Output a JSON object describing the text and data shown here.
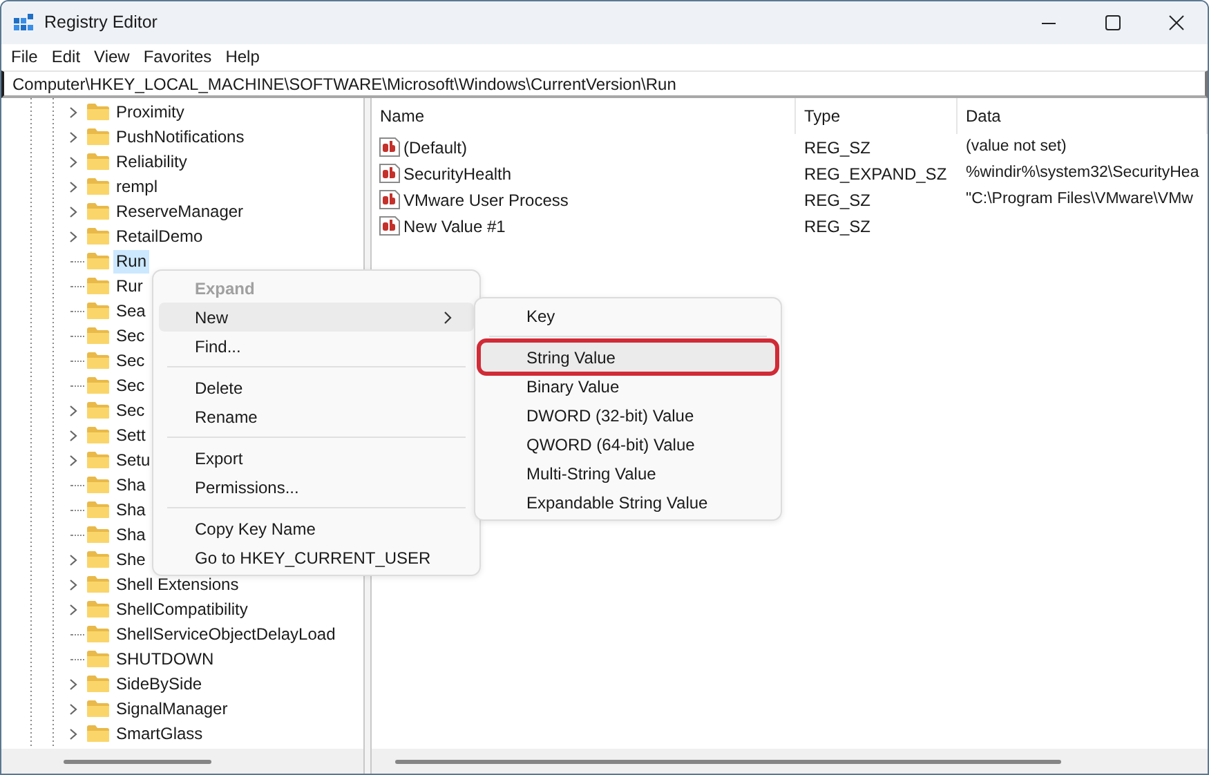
{
  "window": {
    "title": "Registry Editor"
  },
  "menu_bar": [
    "File",
    "Edit",
    "View",
    "Favorites",
    "Help"
  ],
  "address_bar": {
    "value": "Computer\\HKEY_LOCAL_MACHINE\\SOFTWARE\\Microsoft\\Windows\\CurrentVersion\\Run"
  },
  "tree": {
    "items": [
      {
        "label": "Proximity",
        "expandable": true,
        "selected": false
      },
      {
        "label": "PushNotifications",
        "expandable": true,
        "selected": false
      },
      {
        "label": "Reliability",
        "expandable": true,
        "selected": false
      },
      {
        "label": "rempl",
        "expandable": true,
        "selected": false
      },
      {
        "label": "ReserveManager",
        "expandable": true,
        "selected": false
      },
      {
        "label": "RetailDemo",
        "expandable": true,
        "selected": false
      },
      {
        "label": "Run",
        "expandable": false,
        "selected": true
      },
      {
        "label": "Rur",
        "expandable": false,
        "selected": false
      },
      {
        "label": "Sea",
        "expandable": false,
        "selected": false
      },
      {
        "label": "Sec",
        "expandable": false,
        "selected": false
      },
      {
        "label": "Sec",
        "expandable": false,
        "selected": false
      },
      {
        "label": "Sec",
        "expandable": false,
        "selected": false
      },
      {
        "label": "Sec",
        "expandable": true,
        "selected": false
      },
      {
        "label": "Sett",
        "expandable": true,
        "selected": false
      },
      {
        "label": "Setu",
        "expandable": true,
        "selected": false
      },
      {
        "label": "Sha",
        "expandable": false,
        "selected": false
      },
      {
        "label": "Sha",
        "expandable": false,
        "selected": false
      },
      {
        "label": "Sha",
        "expandable": false,
        "selected": false
      },
      {
        "label": "She",
        "expandable": true,
        "selected": false
      },
      {
        "label": "Shell Extensions",
        "expandable": true,
        "selected": false
      },
      {
        "label": "ShellCompatibility",
        "expandable": true,
        "selected": false
      },
      {
        "label": "ShellServiceObjectDelayLoad",
        "expandable": false,
        "selected": false
      },
      {
        "label": "SHUTDOWN",
        "expandable": false,
        "selected": false
      },
      {
        "label": "SideBySide",
        "expandable": true,
        "selected": false
      },
      {
        "label": "SignalManager",
        "expandable": true,
        "selected": false
      },
      {
        "label": "SmartGlass",
        "expandable": true,
        "selected": false
      }
    ]
  },
  "values_list": {
    "columns": [
      "Name",
      "Type",
      "Data"
    ],
    "rows": [
      {
        "name": "(Default)",
        "type": "REG_SZ",
        "data": "(value not set)"
      },
      {
        "name": "SecurityHealth",
        "type": "REG_EXPAND_SZ",
        "data": "%windir%\\system32\\SecurityHea"
      },
      {
        "name": "VMware User Process",
        "type": "REG_SZ",
        "data": "\"C:\\Program Files\\VMware\\VMw"
      },
      {
        "name": "New Value #1",
        "type": "REG_SZ"
      }
    ]
  },
  "context_menu": {
    "items": [
      {
        "kind": "item",
        "label": "Expand",
        "disabled": true,
        "default": true,
        "selected": false,
        "has_submenu": false
      },
      {
        "kind": "item",
        "label": "New",
        "disabled": false,
        "default": false,
        "selected": true,
        "has_submenu": true
      },
      {
        "kind": "item",
        "label": "Find...",
        "disabled": false,
        "default": false,
        "selected": false,
        "has_submenu": false
      },
      {
        "kind": "separator"
      },
      {
        "kind": "item",
        "label": "Delete",
        "disabled": false,
        "default": false,
        "selected": false,
        "has_submenu": false
      },
      {
        "kind": "item",
        "label": "Rename",
        "disabled": false,
        "default": false,
        "selected": false,
        "has_submenu": false
      },
      {
        "kind": "separator"
      },
      {
        "kind": "item",
        "label": "Export",
        "disabled": false,
        "default": false,
        "selected": false,
        "has_submenu": false
      },
      {
        "kind": "item",
        "label": "Permissions...",
        "disabled": false,
        "default": false,
        "selected": false,
        "has_submenu": false
      },
      {
        "kind": "separator"
      },
      {
        "kind": "item",
        "label": "Copy Key Name",
        "disabled": false,
        "default": false,
        "selected": false,
        "has_submenu": false
      },
      {
        "kind": "item",
        "label": "Go to HKEY_CURRENT_USER",
        "disabled": false,
        "default": false,
        "selected": false,
        "has_submenu": false
      }
    ]
  },
  "submenu": {
    "items": [
      {
        "kind": "item",
        "label": "Key",
        "selected": false,
        "annotated": false
      },
      {
        "kind": "separator"
      },
      {
        "kind": "item",
        "label": "String Value",
        "selected": true,
        "annotated": true
      },
      {
        "kind": "item",
        "label": "Binary Value",
        "selected": false,
        "annotated": false
      },
      {
        "kind": "item",
        "label": "DWORD (32-bit) Value",
        "selected": false,
        "annotated": false
      },
      {
        "kind": "item",
        "label": "QWORD (64-bit) Value",
        "selected": false,
        "annotated": false
      },
      {
        "kind": "item",
        "label": "Multi-String Value",
        "selected": false,
        "annotated": false
      },
      {
        "kind": "item",
        "label": "Expandable String Value",
        "selected": false,
        "annotated": false
      }
    ]
  }
}
